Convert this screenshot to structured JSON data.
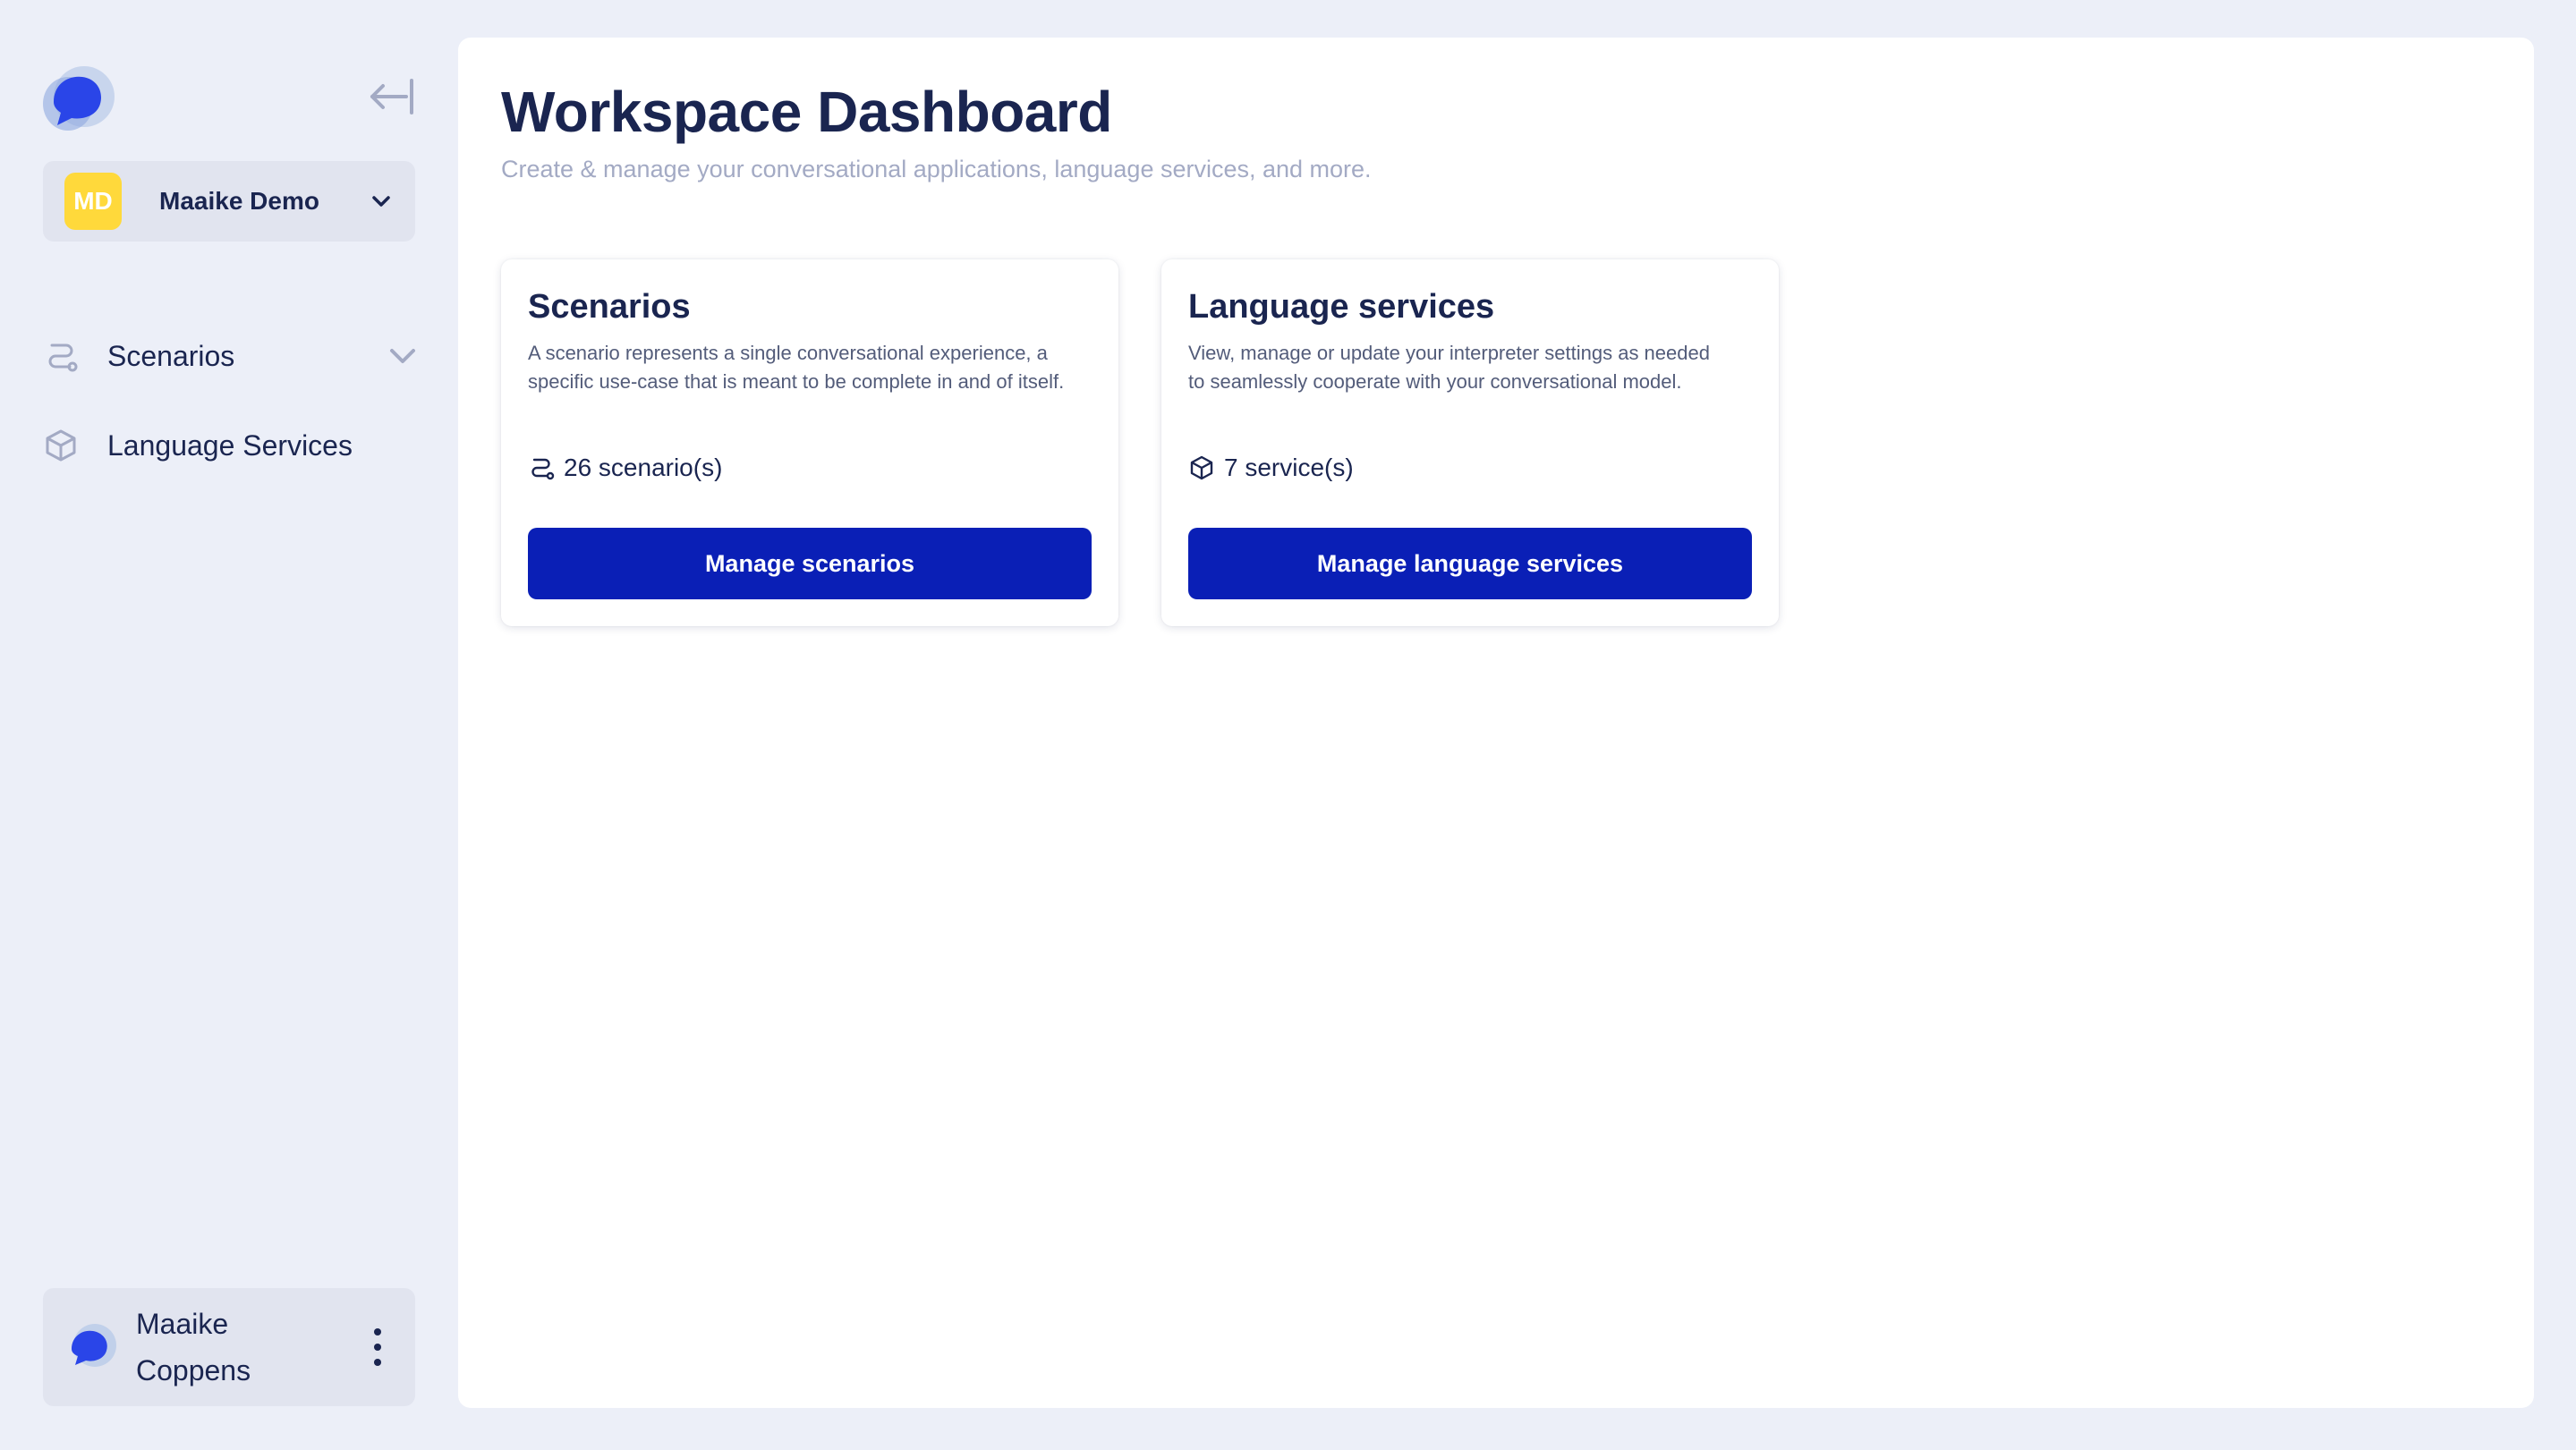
{
  "sidebar": {
    "workspace": {
      "initials": "MD",
      "name": "Maaike Demo"
    },
    "nav": {
      "scenarios": {
        "label": "Scenarios"
      },
      "language": {
        "label": "Language Services"
      }
    },
    "user": {
      "first_name": "Maaike",
      "last_name": "Coppens"
    }
  },
  "main": {
    "title": "Workspace Dashboard",
    "subtitle": "Create & manage your conversational applications, language services, and more.",
    "cards": [
      {
        "title": "Scenarios",
        "description": "A scenario represents a single conversational experience, a specific use-case that is meant to be complete in and of itself.",
        "count": "26 scenario(s)",
        "button": "Manage scenarios"
      },
      {
        "title": "Language services",
        "description": "View, manage or update your interpreter settings as needed to seamlessly cooperate with your conversational model.",
        "count": "7 service(s)",
        "button": "Manage language services"
      }
    ]
  },
  "colors": {
    "background": "#eceff8",
    "panel": "#ffffff",
    "primary_button": "#0a1fb6",
    "text_dark": "#1a2550",
    "text_muted": "#a3aac4",
    "workspace_avatar": "#ffd93b"
  },
  "icons": [
    "app-logo-icon",
    "collapse-sidebar-icon",
    "chevron-down-icon",
    "scenario-flow-icon",
    "cube-icon",
    "kebab-menu-icon"
  ]
}
